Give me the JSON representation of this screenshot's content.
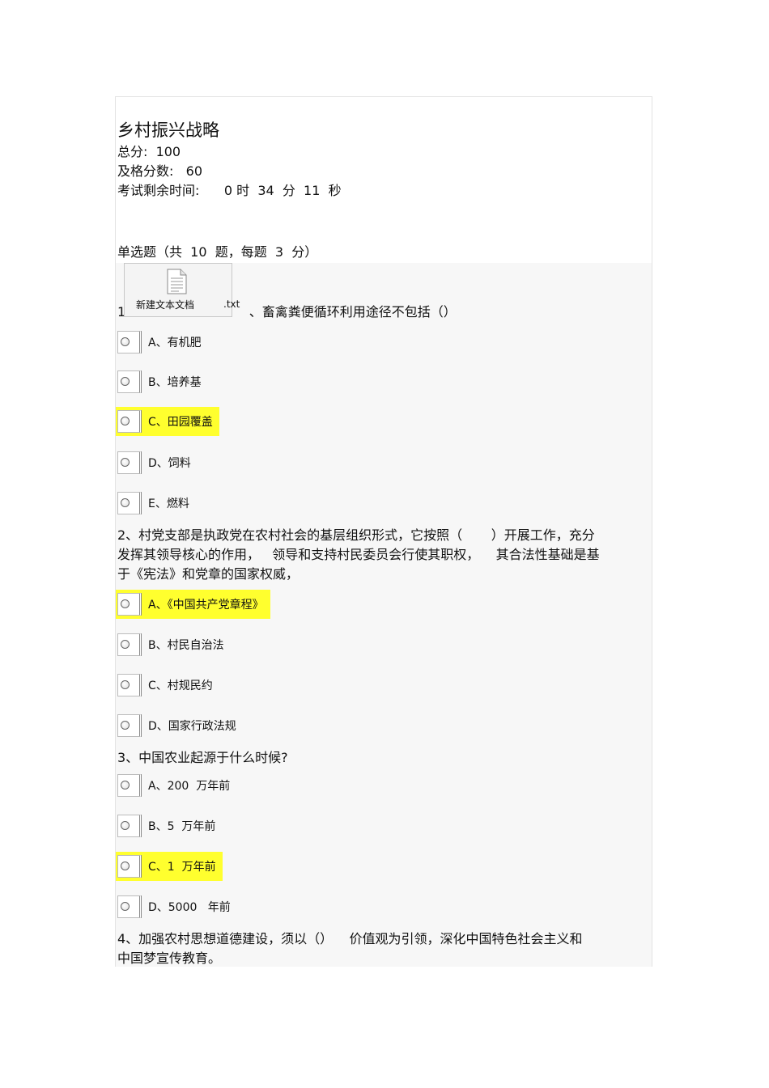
{
  "exam": {
    "title": "乡村振兴战略",
    "total": "总分:  100",
    "pass": "及格分数:   60",
    "time": "考试剩余时间:      0 时  34  分  11  秒"
  },
  "section": {
    "heading": "单选题（共  10  题，每题  3  分）"
  },
  "attachment": {
    "name": "新建文本文档",
    "ext": ".txt",
    "icon": "text-document-icon"
  },
  "questions": [
    {
      "lines": [
        "1                              、畜禽粪便循环利用途径不包括（）"
      ],
      "options": [
        "A、有机肥",
        "B、培养基",
        "C、田园覆盖",
        "D、饲料",
        "E、燃料"
      ],
      "highlighted": 2
    },
    {
      "lines": [
        "2、村党支部是执政党在农村社会的基层组织形式，它按照（       ）开展工作，充分",
        "发挥其领导核心的作用，   领导和支持村民委员会行使其职权，    其合法性基础是基",
        "于《宪法》和党章的国家权威，"
      ],
      "options": [
        "A、《中国共产党章程》",
        "B、村民自治法",
        "C、村规民约",
        "D、国家行政法规"
      ],
      "highlighted": 0
    },
    {
      "lines": [
        "3、中国农业起源于什么时候?"
      ],
      "options": [
        "A、200  万年前",
        "B、5  万年前",
        "C、1  万年前",
        "D、5000   年前"
      ],
      "highlighted": 2
    },
    {
      "lines": [
        "4、加强农村思想道德建设，须以（）    价值观为引领，深化中国特色社会主义和",
        "中国梦宣传教育。"
      ]
    }
  ],
  "colors": {
    "highlight": "#ffff2e",
    "panel": "#f7f7f7"
  }
}
